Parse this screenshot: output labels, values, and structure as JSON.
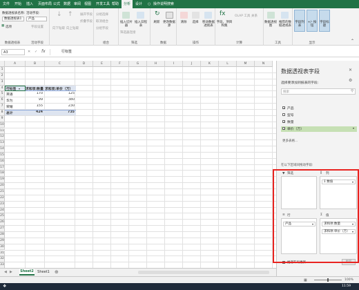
{
  "tabs": [
    "文件",
    "开始",
    "插入",
    "页面布局",
    "公式",
    "数据",
    "审阅",
    "视图",
    "开发工具",
    "帮助",
    "分析",
    "设计"
  ],
  "tell_me": "操作说明搜索",
  "ribbon": {
    "pivot_name_label": "数据透视表名称:",
    "pivot_name_value": "数据透视表1",
    "options_label": "选项",
    "group_pivot": "数据透视表",
    "active_field_label": "活动字段:",
    "active_field_value": "产品",
    "field_settings": "字段设置",
    "drill_down": "向下钻取",
    "drill_up": "向上钻取",
    "expand_field": "展开字段",
    "collapse_field": "折叠字段",
    "group_active_field": "活动字段",
    "group_selection": "分组选择",
    "ungroup": "取消组合",
    "group_field": "分组字段",
    "group_group": "组合",
    "insert_slicer": "插入切片器",
    "insert_timeline": "插入日程表",
    "filter_connections": "筛选器连接",
    "group_filter": "筛选",
    "refresh": "刷新",
    "change_source": "更改数据源",
    "group_data": "数据",
    "clear": "清除",
    "select": "选择",
    "move_pivot": "移动数据透视表",
    "group_actions": "操作",
    "fields_items": "字段、项目和集",
    "olap_tools": "OLAP 工具",
    "relationships": "关系",
    "group_calc": "计算",
    "pivot_chart": "数据透视图",
    "recommended": "推荐的数据透视表",
    "group_tools": "工具",
    "field_list": "字段列表",
    "buttons": "+/- 按钮",
    "field_headers": "字段标题",
    "group_show": "显示"
  },
  "formula": {
    "namebox": "A3",
    "fx": "fx",
    "content": "行标签"
  },
  "columns": [
    "A",
    "B",
    "C",
    "D",
    "E",
    "F",
    "G",
    "H",
    "I",
    "J",
    "K",
    "L",
    "M",
    "N"
  ],
  "rows": [
    "1",
    "2",
    "3",
    "4",
    "5",
    "6",
    "7",
    "8",
    "9",
    "10",
    "11",
    "12",
    "13",
    "14",
    "15",
    "16",
    "17",
    "18",
    "19",
    "20",
    "21",
    "22",
    "23",
    "24",
    "25",
    "26",
    "27",
    "28",
    "29",
    "30",
    "31",
    "32",
    "33",
    "34"
  ],
  "pivot": {
    "header": [
      "行标签",
      "求和项:数量",
      "求和项:单价（万）"
    ],
    "body": [
      [
        "英语",
        "170",
        "125"
      ],
      [
        "华为",
        "99",
        "380"
      ],
      [
        "荣耀",
        "155",
        "230"
      ]
    ],
    "total": [
      "总计",
      "424",
      "735"
    ]
  },
  "sheets": [
    "Sheet2",
    "Sheet1"
  ],
  "status": {
    "zoom": "100%",
    "clock": "11:59"
  },
  "pane": {
    "title": "数据透视表字段",
    "subtitle": "选择要添加到报表的字段:",
    "search_placeholder": "搜索",
    "fields": [
      {
        "label": "产品",
        "checked": true
      },
      {
        "label": "型号",
        "checked": false
      },
      {
        "label": "数量",
        "checked": true
      },
      {
        "label": "单价（万）",
        "checked": true
      }
    ],
    "more_tables": "更多表格...",
    "drag_hint": "在以下区域间拖动字段:",
    "area_filters": "筛选",
    "area_columns": "列",
    "area_rows": "行",
    "area_values": "值",
    "columns_chip": "Σ 数值",
    "rows_chip": "产品",
    "values_chips": [
      "求和项:数量",
      "求和项:单价（万）"
    ],
    "defer": "推迟布局更新",
    "update": "更新"
  }
}
